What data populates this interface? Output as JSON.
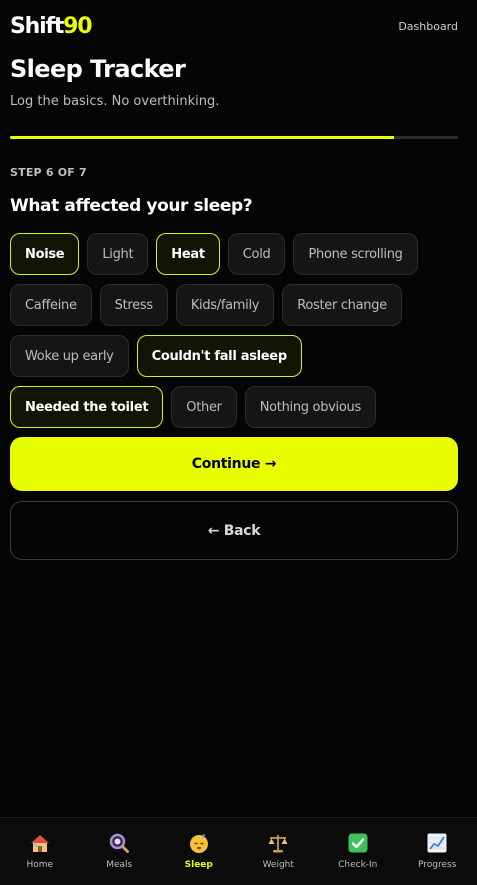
{
  "header": {
    "logo_main": "Shift",
    "logo_accent": "90",
    "dashboard_link": "Dashboard"
  },
  "page": {
    "title": "Sleep Tracker",
    "subtitle": "Log the basics. No overthinking.",
    "progress_fraction": 0.857
  },
  "step": {
    "label": "STEP 6 OF 7",
    "question": "What affected your sleep?"
  },
  "options": [
    {
      "label": "Noise",
      "selected": true
    },
    {
      "label": "Light",
      "selected": false
    },
    {
      "label": "Heat",
      "selected": true
    },
    {
      "label": "Cold",
      "selected": false
    },
    {
      "label": "Phone scrolling",
      "selected": false
    },
    {
      "label": "Caffeine",
      "selected": false
    },
    {
      "label": "Stress",
      "selected": false
    },
    {
      "label": "Kids/family",
      "selected": false
    },
    {
      "label": "Roster change",
      "selected": false
    },
    {
      "label": "Woke up early",
      "selected": false
    },
    {
      "label": "Couldn't fall asleep",
      "selected": true
    },
    {
      "label": "Needed the toilet",
      "selected": true
    },
    {
      "label": "Other",
      "selected": false
    },
    {
      "label": "Nothing obvious",
      "selected": false
    }
  ],
  "actions": {
    "continue_label": "Continue →",
    "back_label": "← Back"
  },
  "colors": {
    "accent": "#e8ff00",
    "background": "#050505"
  },
  "tabbar": {
    "items": [
      {
        "label": "Home",
        "icon": "house-icon",
        "active": false
      },
      {
        "label": "Meals",
        "icon": "magnifier-icon",
        "active": false
      },
      {
        "label": "Sleep",
        "icon": "sleeping-face-icon",
        "active": true
      },
      {
        "label": "Weight",
        "icon": "balance-scale-icon",
        "active": false
      },
      {
        "label": "Check-In",
        "icon": "check-box-icon",
        "active": false
      },
      {
        "label": "Progress",
        "icon": "chart-increasing-icon",
        "active": false
      }
    ]
  }
}
